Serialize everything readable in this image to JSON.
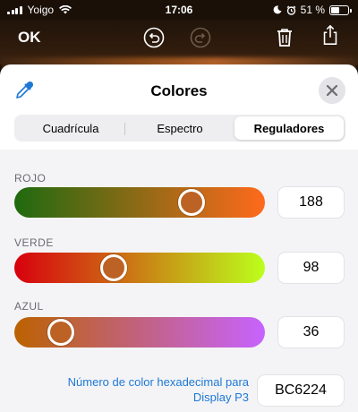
{
  "status_bar": {
    "carrier": "Yoigo",
    "time": "17:06",
    "battery": "51 %",
    "battery_level": 0.51
  },
  "toolbar": {
    "ok_label": "OK",
    "icons": [
      "undo-icon",
      "redo-icon",
      "trash-icon",
      "share-icon"
    ]
  },
  "sheet": {
    "title": "Colores",
    "tabs": [
      {
        "label": "Cuadrícula",
        "active": false
      },
      {
        "label": "Espectro",
        "active": false
      },
      {
        "label": "Reguladores",
        "active": true
      }
    ]
  },
  "sliders": [
    {
      "label": "ROJO",
      "value": "188",
      "level": 0.737,
      "gradient_start": "#1f6a10",
      "gradient_end": "#ff6a1c",
      "knob_color": "#bc6224"
    },
    {
      "label": "VERDE",
      "value": "98",
      "level": 0.384,
      "gradient_start": "#d8000e",
      "gradient_end": "#bcff1c",
      "knob_color": "#bc6224"
    },
    {
      "label": "AZUL",
      "value": "36",
      "level": 0.141,
      "gradient_start": "#bc6200",
      "gradient_end": "#c763ff",
      "knob_color": "#bc6224"
    }
  ],
  "hex": {
    "label": "Número de color hexadecimal para Display P3",
    "value": "BC6224"
  },
  "colors": {
    "accent_link": "#1e78d6",
    "current_color": "#bc6224"
  }
}
